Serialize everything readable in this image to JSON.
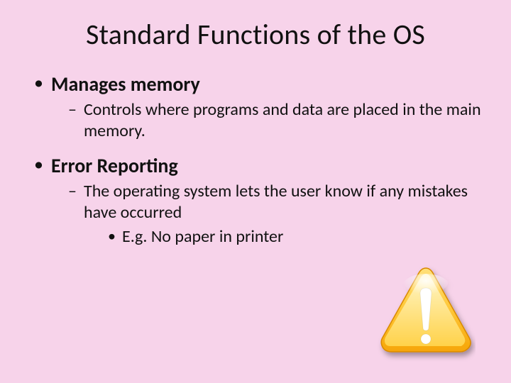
{
  "title": "Standard Functions of the OS",
  "bullets": [
    {
      "label": "Manages memory",
      "sub": [
        {
          "text": "Controls where programs and data are placed in the main memory."
        }
      ]
    },
    {
      "label": "Error Reporting",
      "sub": [
        {
          "text": "The operating system lets the user know if any mistakes have occurred",
          "subsub": [
            {
              "text": "E.g. No paper in printer"
            }
          ]
        }
      ]
    }
  ],
  "icon": "warning-icon"
}
